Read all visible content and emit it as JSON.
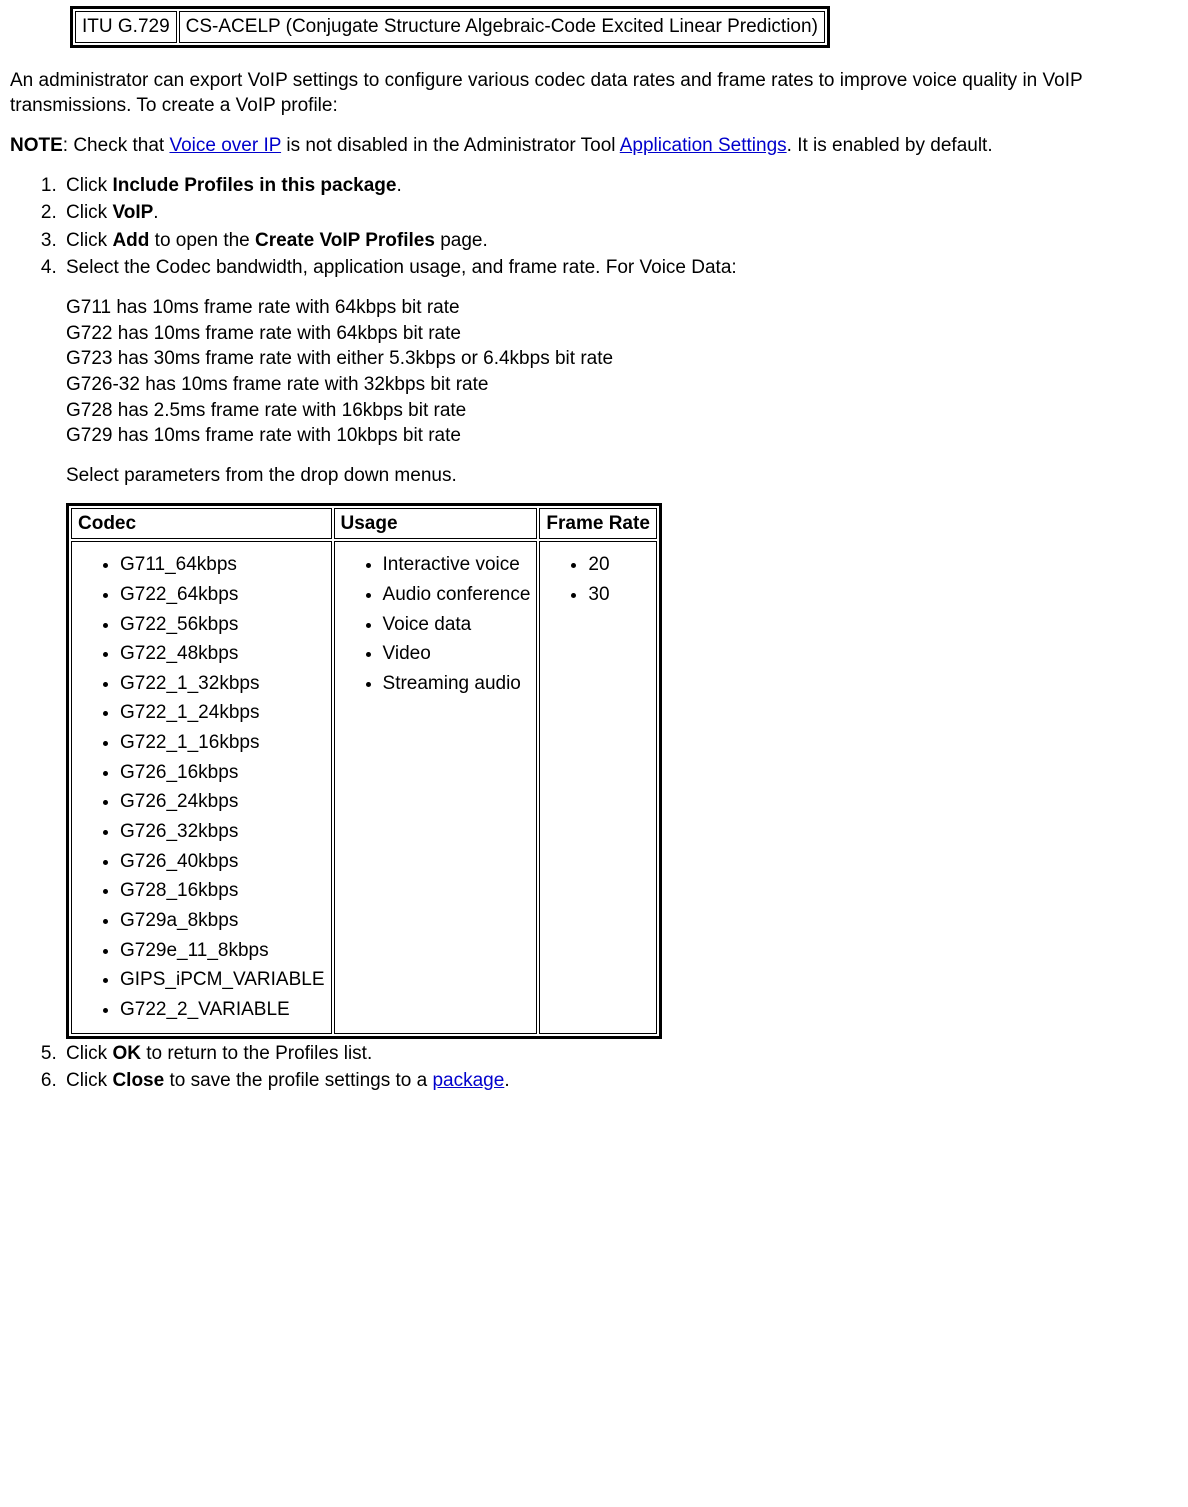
{
  "top_table": {
    "left": "ITU G.729",
    "right": "CS-ACELP (Conjugate Structure Algebraic-Code Excited Linear Prediction)"
  },
  "intro": "An administrator can export VoIP settings to configure various codec data rates and frame rates to improve voice quality in VoIP transmissions. To create a VoIP profile:",
  "note": {
    "label": "NOTE",
    "before": ": Check that ",
    "link1": "Voice over IP",
    "mid": " is not disabled in the Administrator Tool ",
    "link2": "Application Settings",
    "after": ". It is enabled by default."
  },
  "steps": {
    "s1_a": "Click ",
    "s1_b": "Include Profiles in this package",
    "s1_c": ".",
    "s2_a": "Click ",
    "s2_b": "VoIP",
    "s2_c": ".",
    "s3_a": "Click ",
    "s3_b": "Add",
    "s3_c": " to open the ",
    "s3_d": "Create VoIP Profiles",
    "s3_e": " page.",
    "s4": "Select the Codec bandwidth, application usage, and frame rate. For Voice Data:",
    "codec_lines": [
      "G711 has 10ms frame rate with 64kbps bit rate",
      "G722 has 10ms frame rate with 64kbps bit rate",
      "G723 has 30ms frame rate with either 5.3kbps or 6.4kbps bit rate",
      "G726-32 has 10ms frame rate with 32kbps bit rate",
      "G728 has 2.5ms frame rate with 16kbps bit rate",
      "G729 has 10ms frame rate with 10kbps bit rate"
    ],
    "select_params": "Select parameters from the drop down menus.",
    "params_table": {
      "headers": [
        "Codec",
        "Usage",
        "Frame Rate"
      ],
      "codec": [
        "G711_64kbps",
        "G722_64kbps",
        "G722_56kbps",
        "G722_48kbps",
        "G722_1_32kbps",
        "G722_1_24kbps",
        "G722_1_16kbps",
        "G726_16kbps",
        "G726_24kbps",
        "G726_32kbps",
        "G726_40kbps",
        "G728_16kbps",
        "G729a_8kbps",
        "G729e_11_8kbps",
        "GIPS_iPCM_VARIABLE",
        "G722_2_VARIABLE"
      ],
      "usage": [
        "Interactive voice",
        "Audio conference",
        "Voice data",
        "Video",
        "Streaming audio"
      ],
      "frame_rate": [
        "20",
        "30"
      ]
    },
    "s5_a": "Click ",
    "s5_b": "OK",
    "s5_c": " to return to the Profiles list.",
    "s6_a": "Click ",
    "s6_b": "Close",
    "s6_c": " to save the profile settings to a ",
    "s6_link": "package",
    "s6_d": "."
  }
}
